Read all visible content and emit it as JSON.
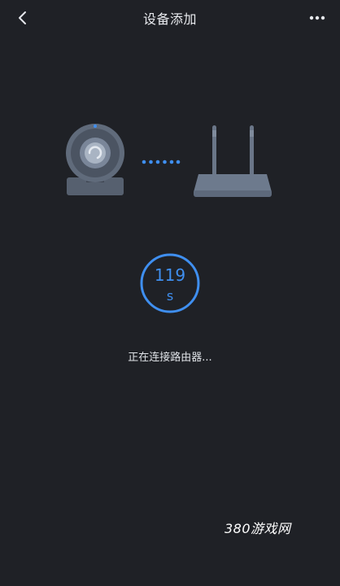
{
  "header": {
    "title": "设备添加",
    "back_icon": "chevron-left-icon",
    "more_icon": "more-horizontal-icon"
  },
  "illustration": {
    "camera_icon": "camera-icon",
    "link_icon": "connecting-dots-icon",
    "router_icon": "router-icon"
  },
  "timer": {
    "value": "119",
    "unit": "s",
    "accent_color": "#3f8ff0"
  },
  "status": {
    "text": "正在连接路由器..."
  },
  "watermark": {
    "text": "380游戏网"
  }
}
